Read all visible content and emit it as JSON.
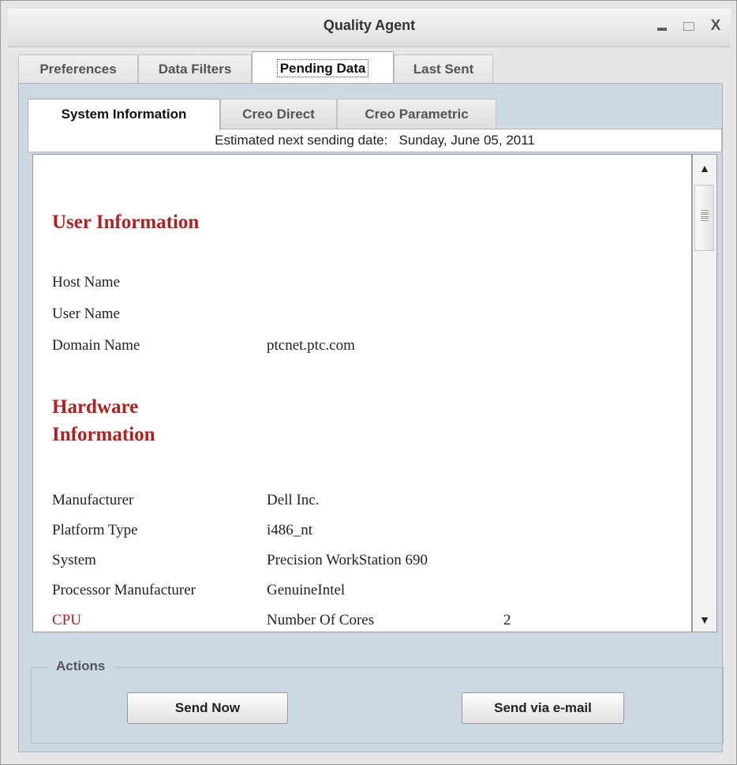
{
  "window": {
    "title": "Quality Agent"
  },
  "main_tabs": [
    "Preferences",
    "Data Filters",
    "Pending Data",
    "Last Sent"
  ],
  "sub_tabs": [
    "System Information",
    "Creo Direct",
    "Creo Parametric"
  ],
  "date_bar": {
    "label": "Estimated next sending date:",
    "value": "Sunday, June 05, 2011"
  },
  "content": {
    "user_info": {
      "title": "User Information",
      "rows": [
        {
          "label": "Host Name",
          "value": ""
        },
        {
          "label": "User Name",
          "value": ""
        },
        {
          "label": "Domain Name",
          "value": "ptcnet.ptc.com"
        }
      ]
    },
    "hardware_info": {
      "title_line1": "Hardware",
      "title_line2": "Information",
      "rows": [
        {
          "label": "Manufacturer",
          "value": "Dell Inc."
        },
        {
          "label": "Platform Type",
          "value": "i486_nt"
        },
        {
          "label": "System",
          "value": "Precision WorkStation 690"
        },
        {
          "label": "Processor Manufacturer",
          "value": "GenuineIntel"
        }
      ],
      "cpu": {
        "label": "CPU",
        "sublabel": "Number Of Cores",
        "value": "2"
      }
    }
  },
  "actions": {
    "legend": "Actions",
    "send_now": "Send Now",
    "send_email": "Send via e-mail"
  },
  "colors": {
    "section_red": "#b61e1e",
    "panel_blue": "#cdd9e2"
  },
  "icons": {
    "minimize": "minimize-icon",
    "maximize": "maximize-icon",
    "close": "close-icon",
    "scroll_up": "arrow-up-icon",
    "scroll_down": "arrow-down-icon"
  }
}
